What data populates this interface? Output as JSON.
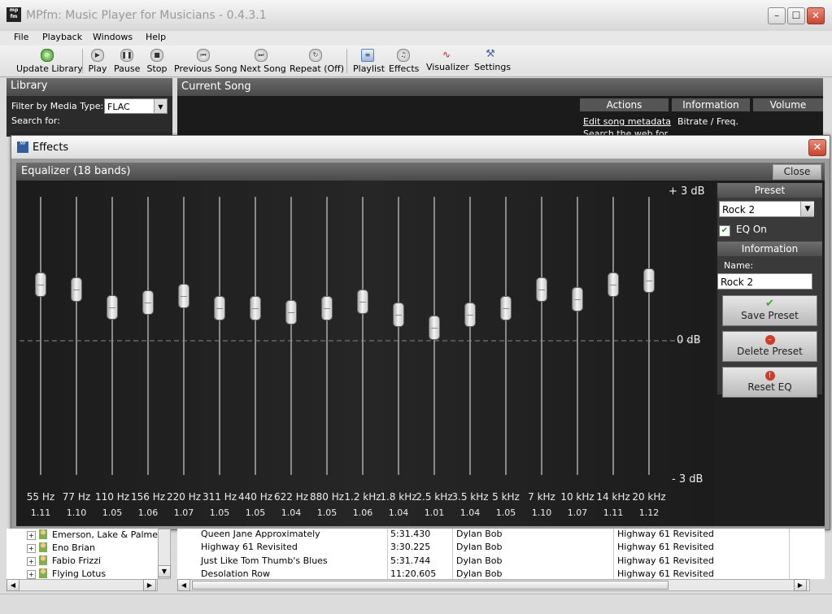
{
  "app": {
    "title": "MPfm: Music Player for Musicians - 0.4.3.1",
    "icon_text": "mp fm"
  },
  "window_buttons": [
    "minimize-icon",
    "maximize-icon",
    "close-icon"
  ],
  "menu": [
    "File",
    "Playback",
    "Windows",
    "Help"
  ],
  "toolbar": {
    "update_library": "Update Library",
    "play": "Play",
    "pause": "Pause",
    "stop": "Stop",
    "previous": "Previous Song",
    "next": "Next Song",
    "repeat": "Repeat (Off)",
    "playlist": "Playlist",
    "effects": "Effects",
    "visualizer": "Visualizer",
    "settings": "Settings"
  },
  "library": {
    "title": "Library",
    "filter_label": "Filter by Media Type:",
    "filter_value": "FLAC",
    "search_label": "Search for:"
  },
  "current_song": {
    "title": "Current Song",
    "actions_header": "Actions",
    "information_header": "Information",
    "volume_header": "Volume",
    "edit_metadata": "Edit song metadata",
    "search_text": "Search the web for",
    "bitrate_label": "Bitrate / Freq."
  },
  "effects": {
    "title": "Effects",
    "eq_title": "Equalizer (18 bands)",
    "close_label": "Close",
    "db_top": "+ 3 dB",
    "db_mid": "0 dB",
    "db_bottom": "- 3 dB",
    "bands": [
      {
        "freq": "55 Hz",
        "gain": "1.11"
      },
      {
        "freq": "77 Hz",
        "gain": "1.10"
      },
      {
        "freq": "110 Hz",
        "gain": "1.05"
      },
      {
        "freq": "156 Hz",
        "gain": "1.06"
      },
      {
        "freq": "220 Hz",
        "gain": "1.07"
      },
      {
        "freq": "311 Hz",
        "gain": "1.05"
      },
      {
        "freq": "440 Hz",
        "gain": "1.05"
      },
      {
        "freq": "622 Hz",
        "gain": "1.04"
      },
      {
        "freq": "880 Hz",
        "gain": "1.05"
      },
      {
        "freq": "1.2 kHz",
        "gain": "1.06"
      },
      {
        "freq": "1.8 kHz",
        "gain": "1.04"
      },
      {
        "freq": "2.5 kHz",
        "gain": "1.01"
      },
      {
        "freq": "3.5 kHz",
        "gain": "1.04"
      },
      {
        "freq": "5 kHz",
        "gain": "1.05"
      },
      {
        "freq": "7 kHz",
        "gain": "1.10"
      },
      {
        "freq": "10 kHz",
        "gain": "1.07"
      },
      {
        "freq": "14 kHz",
        "gain": "1.11"
      },
      {
        "freq": "20 kHz",
        "gain": "1.12"
      }
    ],
    "slider_levels": [
      0.684,
      0.666,
      0.603,
      0.621,
      0.642,
      0.6,
      0.6,
      0.585,
      0.6,
      0.624,
      0.576,
      0.528,
      0.576,
      0.6,
      0.666,
      0.633,
      0.684,
      0.699
    ],
    "preset_header": "Preset",
    "preset_value": "Rock 2",
    "eq_on_label": "EQ On",
    "eq_on_checked": "✔",
    "info_header": "Information",
    "name_label": "Name:",
    "name_value": "Rock 2",
    "save_preset": "Save Preset",
    "delete_preset": "Delete Preset",
    "reset_eq": "Reset EQ"
  },
  "library_tree": [
    "Emerson, Lake & Palmer",
    "Eno Brian",
    "Fabio Frizzi",
    "Flying Lotus"
  ],
  "songs": [
    {
      "title": "Queen Jane Approximately",
      "length": "5:31.430",
      "artist": "Dylan Bob",
      "album": "Highway 61 Revisited"
    },
    {
      "title": "Highway 61 Revisited",
      "length": "3:30.225",
      "artist": "Dylan Bob",
      "album": "Highway 61 Revisited"
    },
    {
      "title": "Just Like Tom Thumb's Blues",
      "length": "5:31.744",
      "artist": "Dylan Bob",
      "album": "Highway 61 Revisited"
    },
    {
      "title": "Desolation Row",
      "length": "11:20.605",
      "artist": "Dylan Bob",
      "album": "Highway 61 Revisited"
    }
  ],
  "colors": {
    "panel_dark": "#1e1e1e",
    "header_gray": "#5a5a5a",
    "close_red": "#c9442f"
  }
}
